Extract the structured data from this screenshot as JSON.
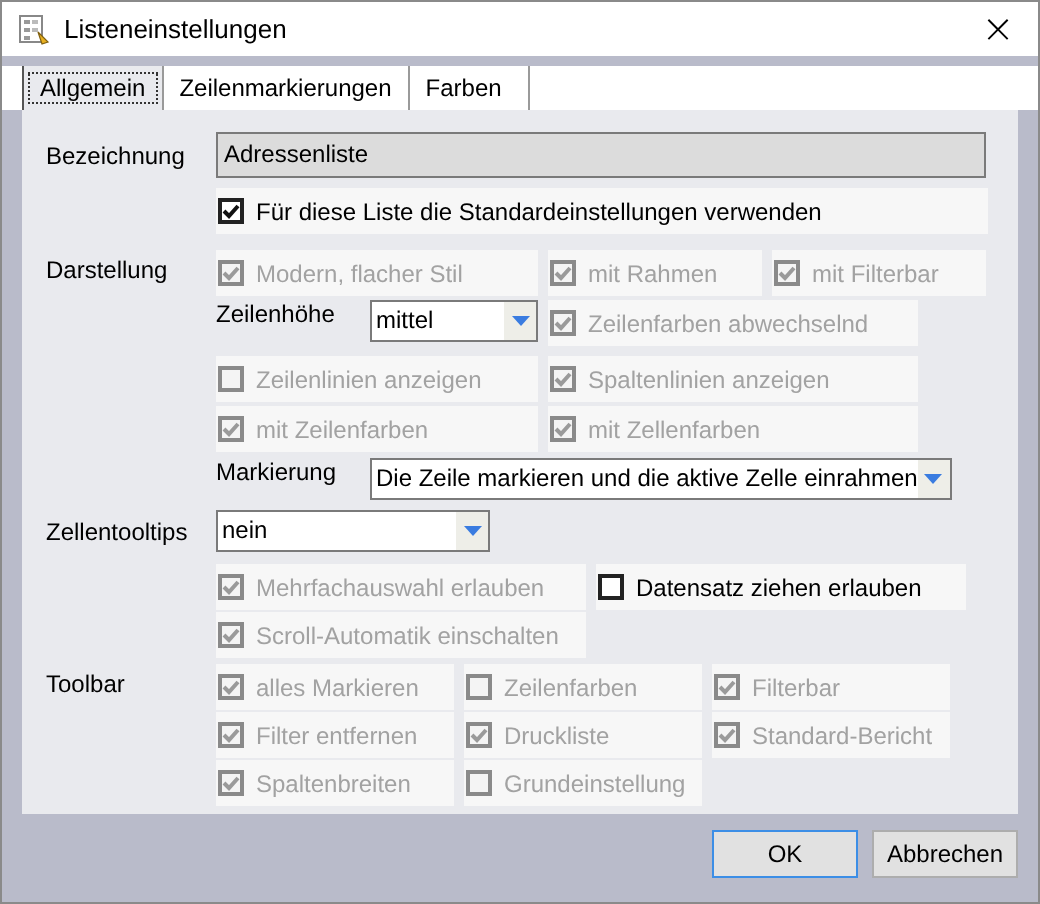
{
  "window": {
    "title": "Listeneinstellungen",
    "close": "×"
  },
  "tabs": [
    {
      "label": "Allgemein",
      "selected": true
    },
    {
      "label": "Zeilenmarkierungen",
      "selected": false
    },
    {
      "label": "Farben",
      "selected": false
    }
  ],
  "name_field": {
    "label": "Bezeichnung",
    "value": "Adressenliste"
  },
  "use_defaults": {
    "label": "Für diese Liste die Standardeinstellungen verwenden",
    "checked": true,
    "disabled": false
  },
  "sections": [
    {
      "label": "Darstellung",
      "rows": [
        [
          {
            "kind": "checkbox",
            "label": "Modern, flacher Stil",
            "checked": true,
            "disabled": true
          },
          {
            "kind": "checkbox",
            "label": "mit Rahmen",
            "checked": true,
            "disabled": true
          },
          {
            "kind": "checkbox",
            "label": "mit Filterbar",
            "checked": true,
            "disabled": true
          }
        ],
        [
          {
            "kind": "dropdown",
            "label": "Zeilenhöhe",
            "value": "mittel"
          },
          {
            "kind": "checkbox",
            "label": "Zeilenfarben abwechselnd",
            "checked": true,
            "disabled": true
          }
        ],
        [
          {
            "kind": "checkbox",
            "label": "Zeilenlinien anzeigen",
            "checked": false,
            "disabled": true
          },
          {
            "kind": "checkbox",
            "label": "Spaltenlinien anzeigen",
            "checked": true,
            "disabled": true
          }
        ],
        [
          {
            "kind": "checkbox",
            "label": "mit Zeilenfarben",
            "checked": true,
            "disabled": true
          },
          {
            "kind": "checkbox",
            "label": "mit Zellenfarben",
            "checked": true,
            "disabled": true
          }
        ],
        [
          {
            "kind": "dropdown",
            "label": "Markierung",
            "value": "Die Zeile markieren und die aktive Zelle einrahmen"
          }
        ]
      ]
    },
    {
      "label": "Zellentooltips",
      "rows": [
        [
          {
            "kind": "dropdown",
            "value": "nein"
          }
        ],
        [
          {
            "kind": "checkbox",
            "label": "Mehrfachauswahl erlauben",
            "checked": true,
            "disabled": true
          },
          {
            "kind": "checkbox",
            "label": "Datensatz ziehen erlauben",
            "checked": false,
            "disabled": false
          }
        ],
        [
          {
            "kind": "checkbox",
            "label": "Scroll-Automatik einschalten",
            "checked": true,
            "disabled": true
          }
        ]
      ]
    },
    {
      "label": "Toolbar",
      "rows": [
        [
          {
            "kind": "checkbox",
            "label": "alles Markieren",
            "checked": true,
            "disabled": true
          },
          {
            "kind": "checkbox",
            "label": "Zeilenfarben",
            "checked": false,
            "disabled": true
          },
          {
            "kind": "checkbox",
            "label": "Filterbar",
            "checked": true,
            "disabled": true
          }
        ],
        [
          {
            "kind": "checkbox",
            "label": "Filter entfernen",
            "checked": true,
            "disabled": true
          },
          {
            "kind": "checkbox",
            "label": "Druckliste",
            "checked": true,
            "disabled": true
          },
          {
            "kind": "checkbox",
            "label": "Standard-Bericht",
            "checked": true,
            "disabled": true
          }
        ],
        [
          {
            "kind": "checkbox",
            "label": "Spaltenbreiten",
            "checked": true,
            "disabled": true
          },
          {
            "kind": "checkbox",
            "label": "Grundeinstellung",
            "checked": false,
            "disabled": true
          }
        ]
      ]
    }
  ],
  "buttons": [
    {
      "label": "OK",
      "default": true
    },
    {
      "label": "Abbrechen",
      "default": false
    }
  ]
}
